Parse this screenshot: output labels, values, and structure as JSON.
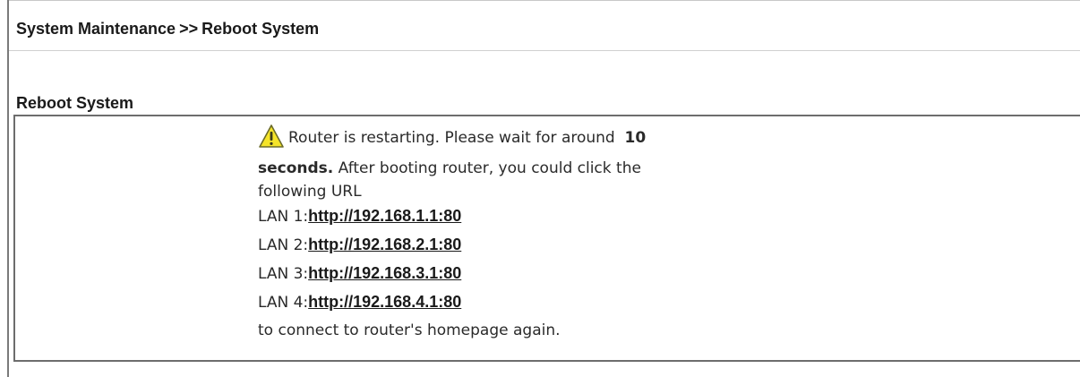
{
  "header": {
    "breadcrumb_parent": "System Maintenance",
    "breadcrumb_separator": ">>",
    "breadcrumb_current": "Reboot System"
  },
  "section": {
    "title": "Reboot System"
  },
  "message": {
    "icon": "warning-triangle-icon",
    "line1_prefix": "Router is restarting. Please wait for around",
    "wait_seconds": "10",
    "seconds_word": "seconds.",
    "line2_rest": " After booting router, you could click the",
    "line3": "following URL",
    "lan_links": [
      {
        "label": "LAN 1:",
        "url": "http://192.168.1.1:80"
      },
      {
        "label": "LAN 2:",
        "url": "http://192.168.2.1:80"
      },
      {
        "label": "LAN 3:",
        "url": "http://192.168.3.1:80"
      },
      {
        "label": "LAN 4:",
        "url": "http://192.168.4.1:80"
      }
    ],
    "closing": "to connect to router's homepage again."
  },
  "colors": {
    "text": "#1a1a1a",
    "panel_border": "#6d6d6d",
    "warning_fill": "#f5e42a",
    "warning_outline": "#6b6b2a"
  }
}
